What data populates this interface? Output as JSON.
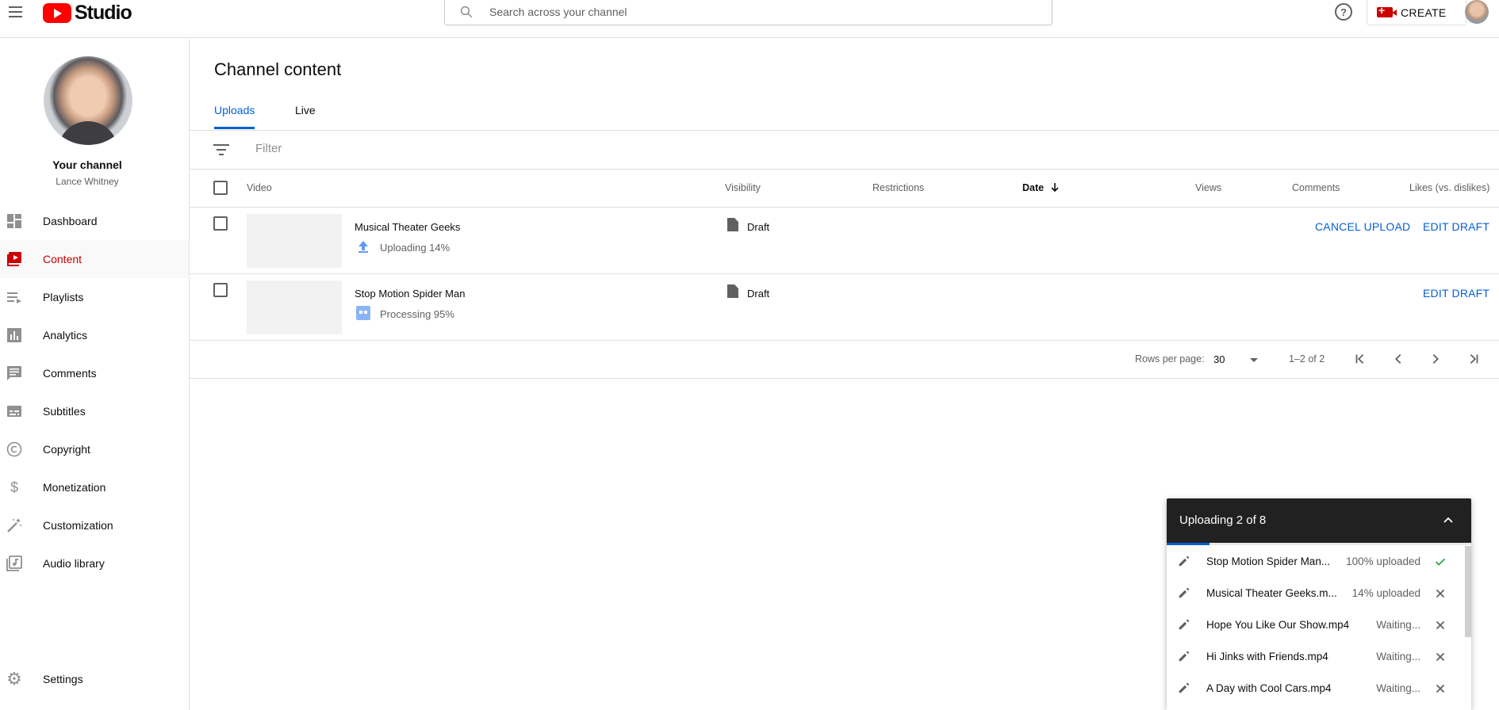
{
  "header": {
    "logo_text": "Studio",
    "search_placeholder": "Search across your channel",
    "help_symbol": "?",
    "create_label": "CREATE"
  },
  "sidebar": {
    "channel_title": "Your channel",
    "channel_name": "Lance Whitney",
    "items": [
      {
        "label": "Dashboard",
        "icon": "dashboard-icon"
      },
      {
        "label": "Content",
        "icon": "content-icon",
        "active": true
      },
      {
        "label": "Playlists",
        "icon": "playlists-icon"
      },
      {
        "label": "Analytics",
        "icon": "analytics-icon"
      },
      {
        "label": "Comments",
        "icon": "comments-icon"
      },
      {
        "label": "Subtitles",
        "icon": "subtitles-icon"
      },
      {
        "label": "Copyright",
        "icon": "copyright-icon"
      },
      {
        "label": "Monetization",
        "icon": "dollar-icon"
      },
      {
        "label": "Customization",
        "icon": "magic-wand-icon"
      },
      {
        "label": "Audio library",
        "icon": "audio-library-icon"
      }
    ],
    "settings_label": "Settings"
  },
  "main": {
    "title": "Channel content",
    "tabs": [
      "Uploads",
      "Live"
    ],
    "filter_placeholder": "Filter",
    "columns": {
      "video": "Video",
      "visibility": "Visibility",
      "restrictions": "Restrictions",
      "date": "Date",
      "views": "Views",
      "comments": "Comments",
      "likes": "Likes (vs. dislikes)"
    },
    "rows": [
      {
        "title": "Musical Theater Geeks",
        "status": "Uploading 14%",
        "visibility": "Draft",
        "cancel": "CANCEL UPLOAD",
        "edit": "EDIT DRAFT"
      },
      {
        "title": "Stop Motion Spider Man",
        "status": "Processing 95%",
        "visibility": "Draft",
        "edit": "EDIT DRAFT"
      }
    ],
    "pagination": {
      "rows_label": "Rows per page:",
      "rows_value": "30",
      "range": "1–2 of 2"
    }
  },
  "upload_panel": {
    "title": "Uploading 2 of 8",
    "progress_fraction": 0.14,
    "items": [
      {
        "name": "Stop Motion Spider Man...",
        "status": "100% uploaded",
        "end_icon": "check-icon"
      },
      {
        "name": "Musical Theater Geeks.m...",
        "status": "14% uploaded",
        "end_icon": "close-icon"
      },
      {
        "name": "Hope You Like Our Show.mp4",
        "status": "Waiting...",
        "end_icon": "close-icon"
      },
      {
        "name": "Hi Jinks with Friends.mp4",
        "status": "Waiting...",
        "end_icon": "close-icon"
      },
      {
        "name": "A Day with Cool Cars.mp4",
        "status": "Waiting...",
        "end_icon": "close-icon"
      }
    ]
  },
  "colors": {
    "accent_blue": "#065fd4",
    "brand_red": "#ff0000",
    "active_red": "#cc0000",
    "success_green": "#2ba640"
  }
}
